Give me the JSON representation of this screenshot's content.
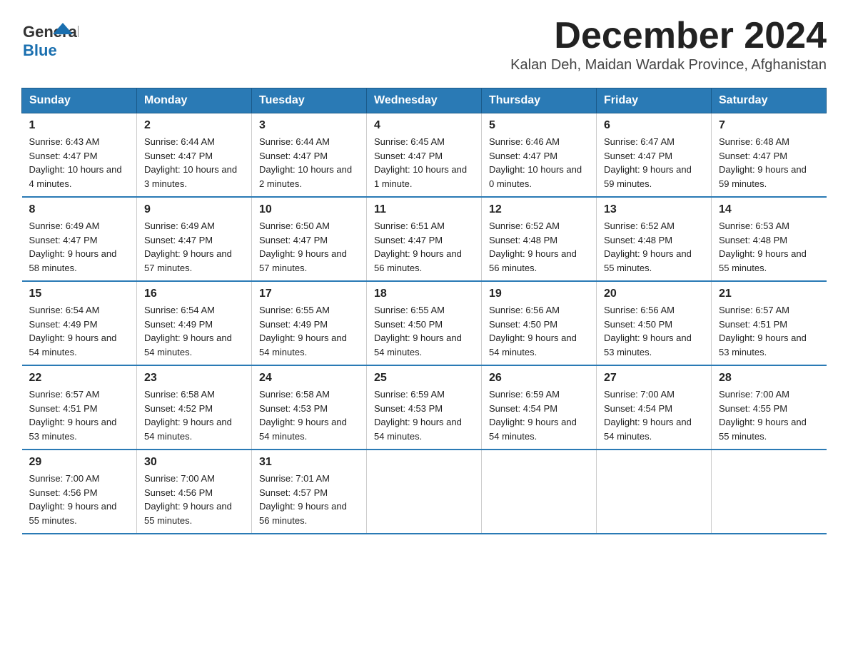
{
  "header": {
    "logo_general": "General",
    "logo_blue": "Blue",
    "month_title": "December 2024",
    "location": "Kalan Deh, Maidan Wardak Province, Afghanistan"
  },
  "weekdays": [
    "Sunday",
    "Monday",
    "Tuesday",
    "Wednesday",
    "Thursday",
    "Friday",
    "Saturday"
  ],
  "weeks": [
    [
      {
        "day": "1",
        "sunrise": "6:43 AM",
        "sunset": "4:47 PM",
        "daylight": "10 hours and 4 minutes."
      },
      {
        "day": "2",
        "sunrise": "6:44 AM",
        "sunset": "4:47 PM",
        "daylight": "10 hours and 3 minutes."
      },
      {
        "day": "3",
        "sunrise": "6:44 AM",
        "sunset": "4:47 PM",
        "daylight": "10 hours and 2 minutes."
      },
      {
        "day": "4",
        "sunrise": "6:45 AM",
        "sunset": "4:47 PM",
        "daylight": "10 hours and 1 minute."
      },
      {
        "day": "5",
        "sunrise": "6:46 AM",
        "sunset": "4:47 PM",
        "daylight": "10 hours and 0 minutes."
      },
      {
        "day": "6",
        "sunrise": "6:47 AM",
        "sunset": "4:47 PM",
        "daylight": "9 hours and 59 minutes."
      },
      {
        "day": "7",
        "sunrise": "6:48 AM",
        "sunset": "4:47 PM",
        "daylight": "9 hours and 59 minutes."
      }
    ],
    [
      {
        "day": "8",
        "sunrise": "6:49 AM",
        "sunset": "4:47 PM",
        "daylight": "9 hours and 58 minutes."
      },
      {
        "day": "9",
        "sunrise": "6:49 AM",
        "sunset": "4:47 PM",
        "daylight": "9 hours and 57 minutes."
      },
      {
        "day": "10",
        "sunrise": "6:50 AM",
        "sunset": "4:47 PM",
        "daylight": "9 hours and 57 minutes."
      },
      {
        "day": "11",
        "sunrise": "6:51 AM",
        "sunset": "4:47 PM",
        "daylight": "9 hours and 56 minutes."
      },
      {
        "day": "12",
        "sunrise": "6:52 AM",
        "sunset": "4:48 PM",
        "daylight": "9 hours and 56 minutes."
      },
      {
        "day": "13",
        "sunrise": "6:52 AM",
        "sunset": "4:48 PM",
        "daylight": "9 hours and 55 minutes."
      },
      {
        "day": "14",
        "sunrise": "6:53 AM",
        "sunset": "4:48 PM",
        "daylight": "9 hours and 55 minutes."
      }
    ],
    [
      {
        "day": "15",
        "sunrise": "6:54 AM",
        "sunset": "4:49 PM",
        "daylight": "9 hours and 54 minutes."
      },
      {
        "day": "16",
        "sunrise": "6:54 AM",
        "sunset": "4:49 PM",
        "daylight": "9 hours and 54 minutes."
      },
      {
        "day": "17",
        "sunrise": "6:55 AM",
        "sunset": "4:49 PM",
        "daylight": "9 hours and 54 minutes."
      },
      {
        "day": "18",
        "sunrise": "6:55 AM",
        "sunset": "4:50 PM",
        "daylight": "9 hours and 54 minutes."
      },
      {
        "day": "19",
        "sunrise": "6:56 AM",
        "sunset": "4:50 PM",
        "daylight": "9 hours and 54 minutes."
      },
      {
        "day": "20",
        "sunrise": "6:56 AM",
        "sunset": "4:50 PM",
        "daylight": "9 hours and 53 minutes."
      },
      {
        "day": "21",
        "sunrise": "6:57 AM",
        "sunset": "4:51 PM",
        "daylight": "9 hours and 53 minutes."
      }
    ],
    [
      {
        "day": "22",
        "sunrise": "6:57 AM",
        "sunset": "4:51 PM",
        "daylight": "9 hours and 53 minutes."
      },
      {
        "day": "23",
        "sunrise": "6:58 AM",
        "sunset": "4:52 PM",
        "daylight": "9 hours and 54 minutes."
      },
      {
        "day": "24",
        "sunrise": "6:58 AM",
        "sunset": "4:53 PM",
        "daylight": "9 hours and 54 minutes."
      },
      {
        "day": "25",
        "sunrise": "6:59 AM",
        "sunset": "4:53 PM",
        "daylight": "9 hours and 54 minutes."
      },
      {
        "day": "26",
        "sunrise": "6:59 AM",
        "sunset": "4:54 PM",
        "daylight": "9 hours and 54 minutes."
      },
      {
        "day": "27",
        "sunrise": "7:00 AM",
        "sunset": "4:54 PM",
        "daylight": "9 hours and 54 minutes."
      },
      {
        "day": "28",
        "sunrise": "7:00 AM",
        "sunset": "4:55 PM",
        "daylight": "9 hours and 55 minutes."
      }
    ],
    [
      {
        "day": "29",
        "sunrise": "7:00 AM",
        "sunset": "4:56 PM",
        "daylight": "9 hours and 55 minutes."
      },
      {
        "day": "30",
        "sunrise": "7:00 AM",
        "sunset": "4:56 PM",
        "daylight": "9 hours and 55 minutes."
      },
      {
        "day": "31",
        "sunrise": "7:01 AM",
        "sunset": "4:57 PM",
        "daylight": "9 hours and 56 minutes."
      },
      null,
      null,
      null,
      null
    ]
  ]
}
